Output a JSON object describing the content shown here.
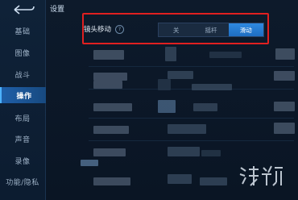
{
  "header": {
    "title": "设置"
  },
  "sidebar": {
    "items": [
      {
        "label": "基础"
      },
      {
        "label": "图像"
      },
      {
        "label": "战斗"
      },
      {
        "label": "操作"
      },
      {
        "label": "布局"
      },
      {
        "label": "声音"
      },
      {
        "label": "录像"
      },
      {
        "label": "功能/隐私"
      }
    ]
  },
  "camera_move": {
    "label": "镜头移动",
    "options": [
      "关",
      "摇杆",
      "滑动"
    ],
    "selected": "滑动"
  },
  "colors": {
    "accent": "#2f89e0",
    "highlight_box": "#e02020",
    "background": "#0b1626"
  }
}
